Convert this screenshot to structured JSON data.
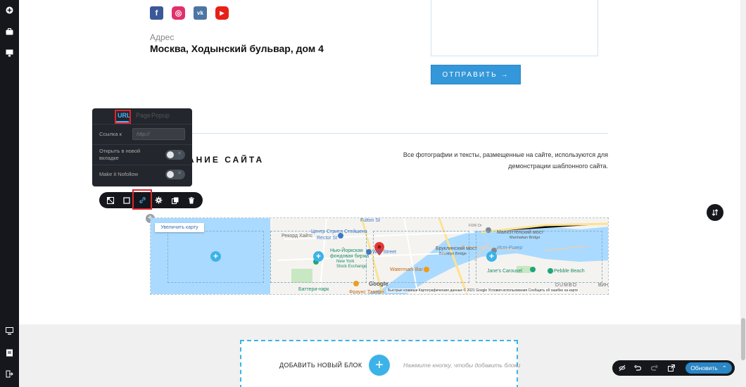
{
  "rail": {
    "icons": [
      "add-icon",
      "briefcase-icon",
      "monitor-edit-icon",
      "desktop-icon",
      "pages-icon",
      "logout-icon"
    ]
  },
  "socials": {
    "facebook": "f",
    "instagram": "◎",
    "vk": "vk",
    "youtube": "▶"
  },
  "contact": {
    "address_label": "Адрес",
    "address_value": "Москва, Ходынский бульвар, дом 4"
  },
  "form": {
    "send_label": "ОТПРАВИТЬ →"
  },
  "footer": {
    "site_name": "НАЗВАНИЕ САЙТА",
    "disclaimer_line1": "Все фотографии и тексты, размещенные на сайте, используются для",
    "disclaimer_line2": "демонстрации шаблонного сайта."
  },
  "link_popover": {
    "tabs": [
      "URL",
      "Page",
      "Popup"
    ],
    "active_tab": "URL",
    "link_to_label": "Ссылка к",
    "link_placeholder": "http://",
    "new_tab_label_line1": "Открыть в новой",
    "new_tab_label_line2": "вкладке",
    "nofollow_label": "Make it Nofollow",
    "toggle_x": "✕"
  },
  "element_toolbar": {
    "buttons": [
      "crop-icon",
      "square-icon",
      "link-icon",
      "gear-icon",
      "duplicate-icon",
      "trash-icon"
    ],
    "active": "link-icon"
  },
  "map": {
    "enlarge_label": "Увеличить карту",
    "labels": {
      "l1": "Fulton St",
      "l2": "Рекорд Хайтс",
      "l3": "Центр Стритл Стейшенз",
      "l4": "Rector St",
      "l5": "Нью-Йоркская",
      "l6": "фондовая биржа",
      "l7": "New York",
      "l8": "Stock Exchange",
      "l9": "Wall Street",
      "l10": "Манхэттенский мост",
      "l11": "Manhattan Bridge",
      "l12": "Бруклинский мост",
      "l13": "Brooklyn Bridge",
      "l14": "Ист-Ривер",
      "l15": "Watermark Bar",
      "l16": "Jane's Carousel",
      "l17": "Pebble Beach",
      "l18": "Баттери-парк",
      "l19": "Фраунс Таверн",
      "l20": "DUMBO",
      "l21": "ВИН",
      "l22": "FDR Dr",
      "google": "Google",
      "footer": "Быстрые клавиши   Картографические данные © 2021 Google   Условия использования   Сообщить об ошибке на карте"
    }
  },
  "add_block": {
    "label": "ДОБАВИТЬ НОВЫЙ БЛОК",
    "hint": "Нажмите кнопку, чтобы добавить блоки"
  },
  "bottom_bar": {
    "icons": [
      "hide-icon",
      "undo-icon",
      "redo-icon",
      "external-preview-icon"
    ],
    "update_label": "Обновить",
    "update_caret": "⌃"
  },
  "colors": {
    "accent": "#3cb3e8",
    "primary_button": "#3497d9",
    "dark_ui": "#15171c",
    "highlight_box": "#e0262e"
  }
}
